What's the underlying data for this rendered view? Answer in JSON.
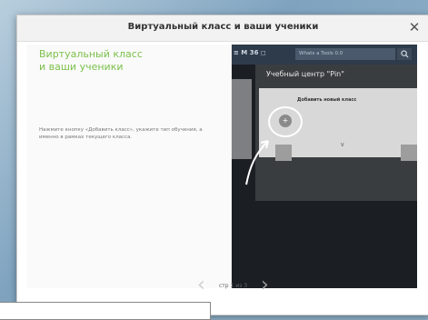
{
  "dialog": {
    "title": "Виртуальный класс и ваши ученики",
    "close_glyph": "✕",
    "close_icon": "close-icon"
  },
  "left": {
    "heading_line1": "Виртуальный класс",
    "heading_line2": "и ваши ученики",
    "description": "Нажмите кнопку «Добавить класс», укажите тип обучения, а именно в рамках текущего класса."
  },
  "preview": {
    "logo": "≡ M 36 ◻",
    "search_placeholder": "Whats a Tools 0.0",
    "search_icon": "search-icon",
    "panel_title": "Учебный центр \"Pin\"",
    "card_title": "Добавить новый класс",
    "card_small_text": "V",
    "add_icon": "plus-icon",
    "add_glyph": "+"
  },
  "nav": {
    "prev_glyph": "‹",
    "next_glyph": "›",
    "page_indicator": "стр 1 из 3"
  },
  "colors": {
    "accent_green": "#7cc04b",
    "preview_bg": "#1b1f23"
  }
}
